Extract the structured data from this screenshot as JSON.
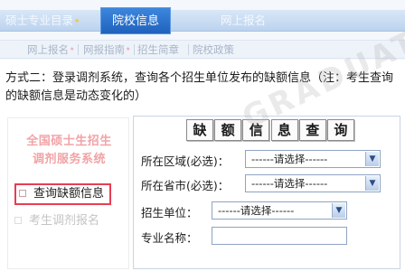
{
  "nav": {
    "primary": [
      {
        "label": "硕士专业目录",
        "star": true
      },
      {
        "label": "院校信息",
        "star": false
      },
      {
        "label": "网上报名",
        "star": false
      }
    ],
    "secondary": [
      {
        "label": "网上报名",
        "star": true
      },
      {
        "label": "网报指南",
        "star": true
      },
      {
        "label": "招生简章",
        "star": false
      },
      {
        "label": "院校政策",
        "star": false
      }
    ],
    "active_color": "#2a6fcb"
  },
  "intro": "方式二：登录调剂系统，查询各个招生单位发布的缺额信息（注：考生查询的缺额信息是动态变化的）",
  "left_panel": {
    "title_line1": "全国硕士生招生",
    "title_line2": "调剂服务系统",
    "items": [
      {
        "label": "查询缺额信息",
        "state": "active"
      },
      {
        "label": "考生调剂报名",
        "state": "dim"
      }
    ],
    "highlight_color": "#e63e54"
  },
  "form": {
    "title_chars": [
      "缺",
      "额",
      "信",
      "息",
      "查",
      "询"
    ],
    "region_label": "所在区域(必选)：",
    "region_value": "------请选择------",
    "province_label": "所在省市(必选)：",
    "province_value": "------请选择------",
    "unit_label": "招生单位：",
    "unit_value": "------请选择------",
    "major_label": "专业名称：",
    "major_value": ""
  },
  "watermark": "GRADUATE ZAIXIAN",
  "icons": [
    "star-icon",
    "checkbox-icon",
    "dropdown-arrow-icon"
  ]
}
